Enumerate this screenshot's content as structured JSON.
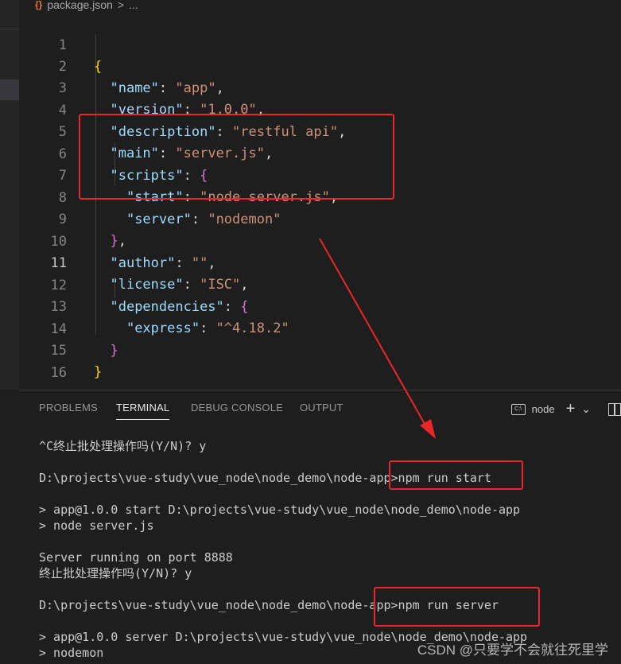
{
  "breadcrumb": {
    "file": "package.json",
    "separator": ">",
    "rest": "..."
  },
  "editor": {
    "active_line": 11,
    "lines": [
      {
        "num": "1"
      },
      {
        "num": "2",
        "key": "\"name\"",
        "value": "\"app\""
      },
      {
        "num": "3",
        "key": "\"version\"",
        "value": "\"1.0.0\""
      },
      {
        "num": "4",
        "key": "\"description\"",
        "value": "\"restful api\""
      },
      {
        "num": "5",
        "key": "\"main\"",
        "value": "\"server.js\""
      },
      {
        "num": "6",
        "key": "\"scripts\""
      },
      {
        "num": "7",
        "key": "\"start\"",
        "value": "\"node server.js\""
      },
      {
        "num": "8",
        "key": "\"server\"",
        "value": "\"nodemon\""
      },
      {
        "num": "9"
      },
      {
        "num": "10",
        "key": "\"author\"",
        "value": "\"\""
      },
      {
        "num": "11",
        "key": "\"license\"",
        "value": "\"ISC\""
      },
      {
        "num": "12",
        "key": "\"dependencies\""
      },
      {
        "num": "13",
        "key": "\"express\"",
        "value": "\"^4.18.2\""
      },
      {
        "num": "14"
      },
      {
        "num": "15"
      },
      {
        "num": "16"
      }
    ]
  },
  "panel": {
    "tabs": [
      "PROBLEMS",
      "TERMINAL",
      "DEBUG CONSOLE",
      "OUTPUT"
    ],
    "active_tab": "TERMINAL",
    "terminal_name": "node",
    "add_glyph": "+",
    "dropdown_glyph": "⌄"
  },
  "terminal": {
    "lines": [
      "^C终止批处理操作吗(Y/N)? y",
      "",
      "D:\\projects\\vue-study\\vue_node\\node_demo\\node-app>npm run start",
      "",
      "> app@1.0.0 start D:\\projects\\vue-study\\vue_node\\node_demo\\node-app",
      "> node server.js",
      "",
      "Server running on port 8888",
      "终止批处理操作吗(Y/N)? y",
      "",
      "D:\\projects\\vue-study\\vue_node\\node_demo\\node-app>npm run server",
      "",
      "> app@1.0.0 server D:\\projects\\vue-study\\vue_node\\node_demo\\node-app",
      "> nodemon"
    ]
  },
  "watermark": "CSDN @只要学不会就往死里学",
  "colors": {
    "annotation_red": "#e8262b",
    "json_key": "#9cdcfe",
    "json_string": "#ce9178",
    "brace": "#ffd700"
  }
}
